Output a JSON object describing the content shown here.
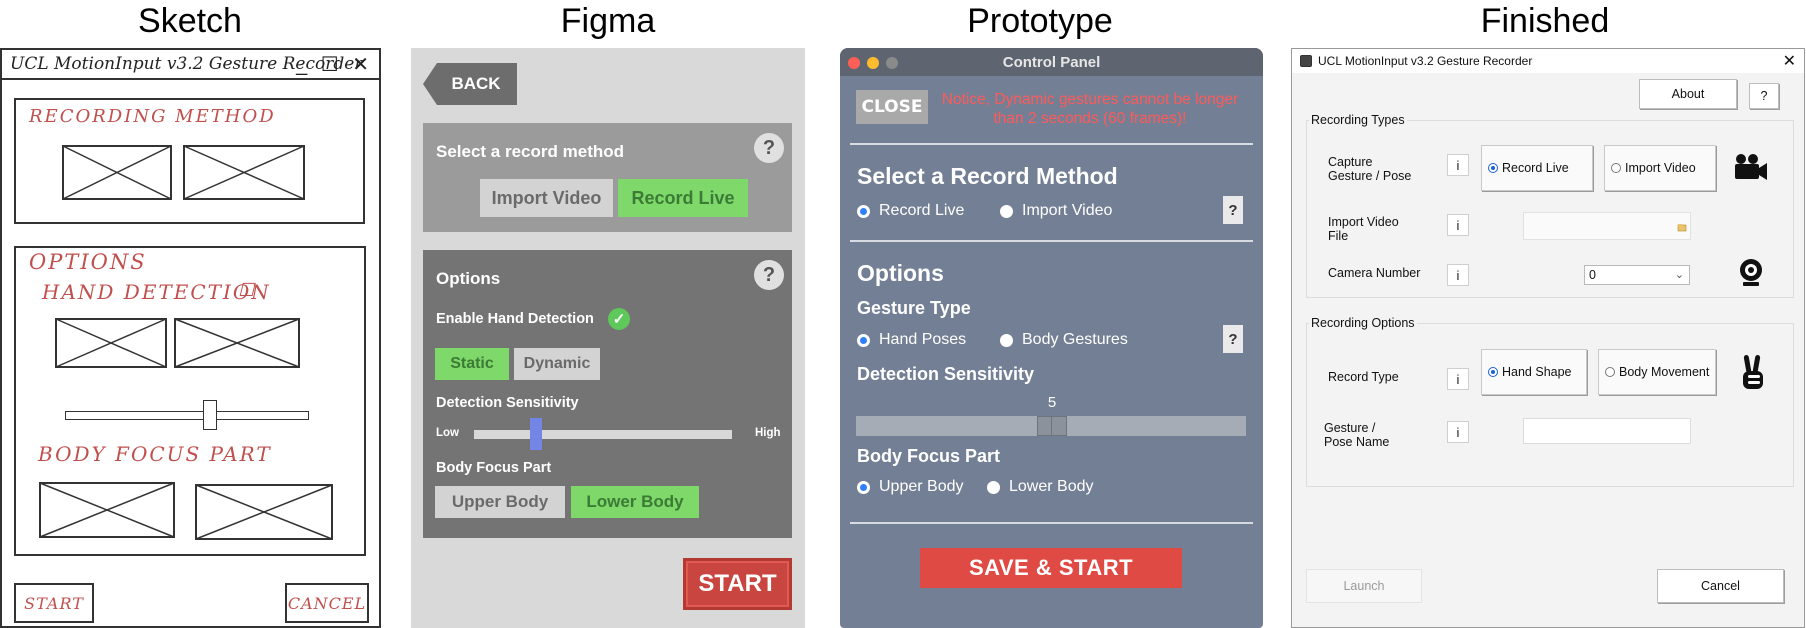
{
  "headings": {
    "sketch": "Sketch",
    "figma": "Figma",
    "prototype": "Prototype",
    "finished": "Finished"
  },
  "sketch": {
    "title": "UCL MotionInput v3.2 Gesture Recorder",
    "window_controls": "_ ☐ ✕",
    "recording_method": "RECORDING METHOD",
    "options": "OPTIONS",
    "hand_detection": "HAND DETECTION",
    "hand_detection_box": "☐",
    "body_focus_part": "BODY FOCUS PART",
    "start": "START",
    "cancel": "CANCEL"
  },
  "figma": {
    "back": "BACK",
    "select_record_method": "Select a record method",
    "help": "?",
    "import_video": "Import Video",
    "record_live": "Record Live",
    "options": "Options",
    "enable_hand_detection": "Enable Hand Detection",
    "check": "✓",
    "static": "Static",
    "dynamic": "Dynamic",
    "detection_sensitivity": "Detection Sensitivity",
    "low": "Low",
    "high": "High",
    "sensitivity_level": 0.24,
    "body_focus_part": "Body Focus Part",
    "upper_body": "Upper Body",
    "lower_body": "Lower Body",
    "start": "START"
  },
  "prototype": {
    "window_title": "Control Panel",
    "close": "CLOSE",
    "notice": "Notice, Dynamic gestures cannot be longer than 2 seconds (60 frames)!",
    "select_record_method": "Select a Record Method",
    "record_live": "Record Live",
    "import_video": "Import Video",
    "help": "?",
    "options": "Options",
    "gesture_type": "Gesture Type",
    "hand_poses": "Hand Poses",
    "body_gestures": "Body Gestures",
    "detection_sensitivity": "Detection Sensitivity",
    "sensitivity_value": "5",
    "body_focus_part": "Body Focus Part",
    "upper_body": "Upper Body",
    "lower_body": "Lower Body",
    "save_start": "SAVE & START",
    "colors": {
      "accent": "#e04a44",
      "panel": "#737f94",
      "notice": "#ff5a5a"
    }
  },
  "finished": {
    "window_title": "UCL MotionInput v3.2 Gesture Recorder",
    "close": "✕",
    "about": "About",
    "help": "?",
    "recording_types": "Recording Types",
    "capture_gesture_pose": "Capture Gesture / Pose",
    "info": "i",
    "record_live": "Record Live",
    "import_video": "Import Video",
    "import_video_file": "Import Video File",
    "camera_number": "Camera Number",
    "camera_value": "0",
    "recording_options": "Recording Options",
    "record_type": "Record Type",
    "hand_shape": "Hand Shape",
    "body_movement": "Body Movement",
    "gesture_pose_name": "Gesture / Pose Name",
    "launch": "Launch",
    "cancel": "Cancel",
    "icons": [
      "video-camera-icon",
      "webcam-icon",
      "peace-hand-icon",
      "folder-icon"
    ]
  }
}
